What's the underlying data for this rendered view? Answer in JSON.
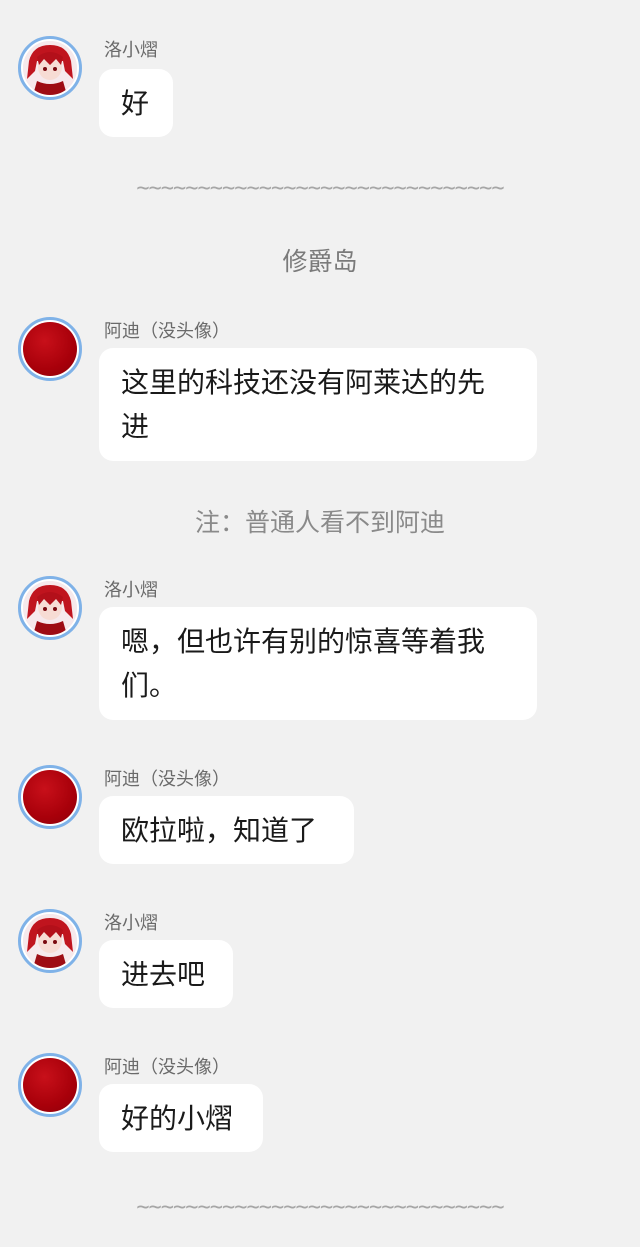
{
  "messages": [
    {
      "sender": "洛小熠",
      "text": "好"
    },
    {
      "sender": "阿迪（没头像）",
      "text": "这里的科技还没有阿莱达的先\n进"
    },
    {
      "sender": "洛小熠",
      "text": "嗯，但也许有别的惊喜等着我\n们。"
    },
    {
      "sender": "阿迪（没头像）",
      "text": "欧拉啦，知道了"
    },
    {
      "sender": "洛小熠",
      "text": "进去吧"
    },
    {
      "sender": "阿迪（没头像）",
      "text": "好的小熠"
    }
  ],
  "dividers": [
    "~~~~~~~~~~~~~~~~~~~~~~~~~~~~~~",
    "~~~~~~~~~~~~~~~~~~~~~~~~~~~~~~"
  ],
  "scene_title": "修爵岛",
  "note": "注：普通人看不到阿迪",
  "colors": {
    "background": "#f1f1f1",
    "bubble": "#ffffff",
    "avatar_ring": "#7fb2e8",
    "avatar_red": "#b0000c"
  },
  "icons": {
    "avatar_char": "anime-character-avatar-icon",
    "avatar_plain": "red-circle-avatar-icon"
  }
}
